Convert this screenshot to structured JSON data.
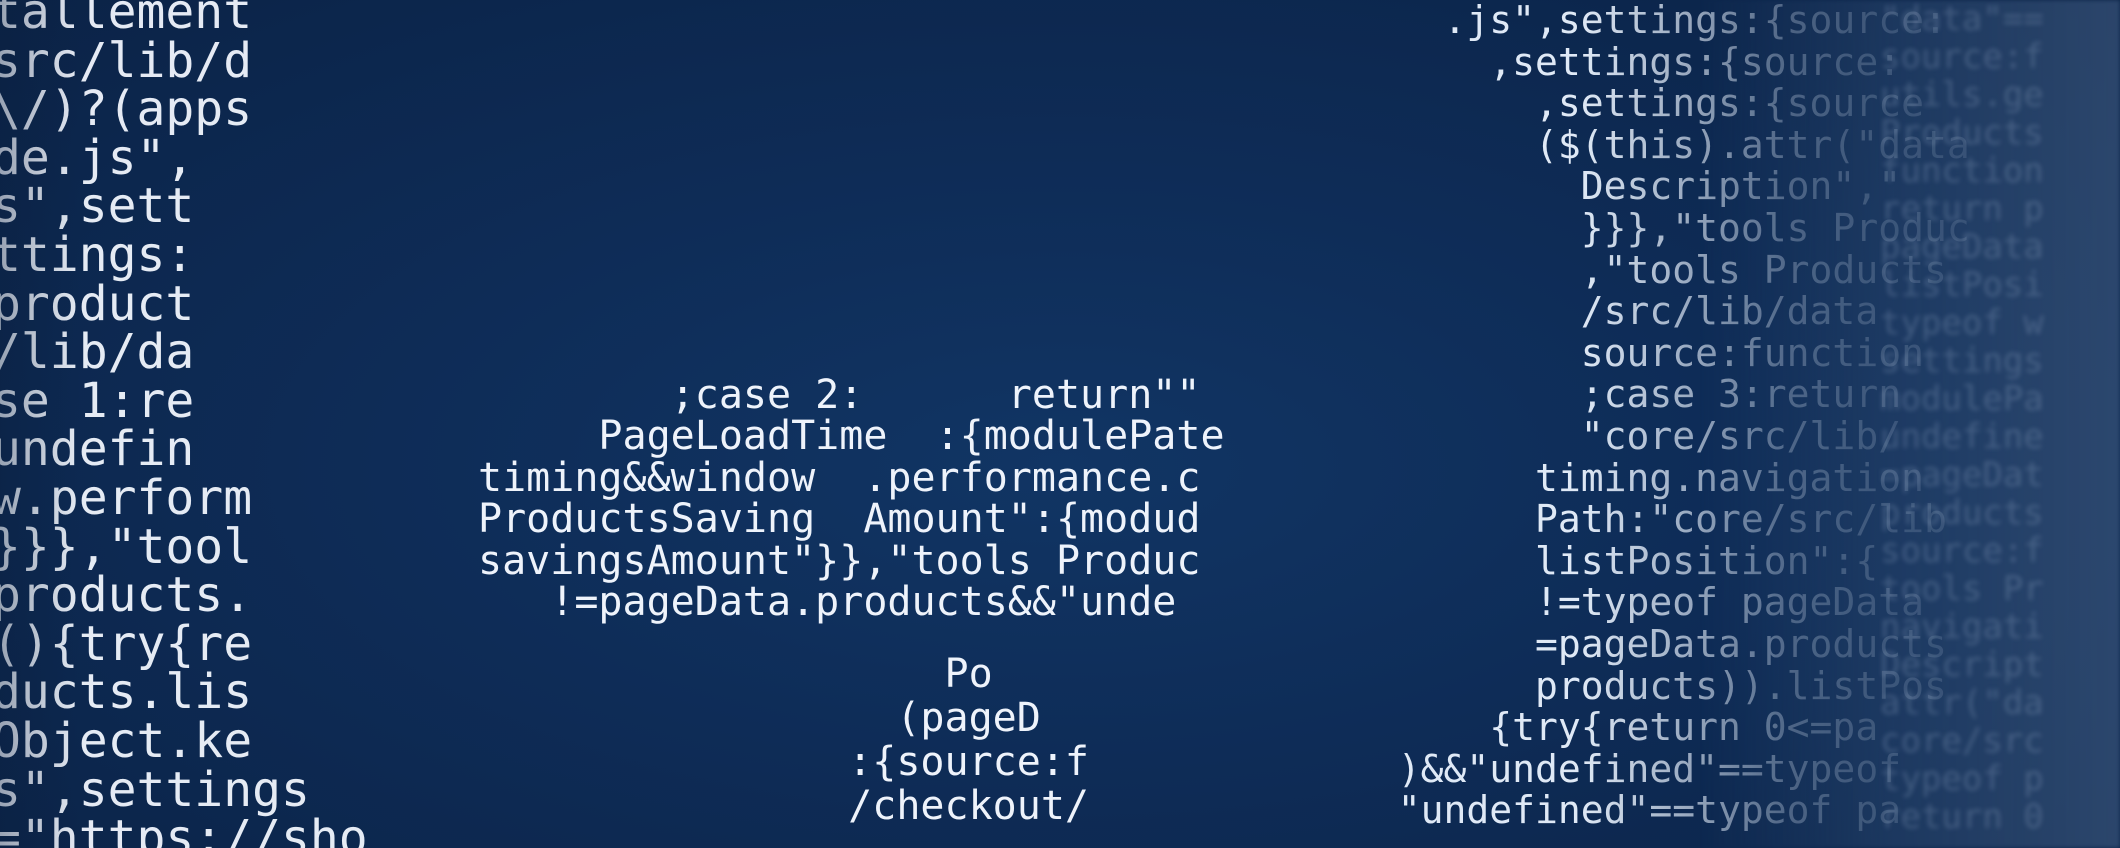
{
  "colors": {
    "background": "#0f2a52",
    "code_text": "#eef3fb"
  },
  "left_block": {
    "lines": [
      "tallement",
      "src/lib/d",
      "\\/)?(apps",
      "de.js\",",
      "s\",sett",
      "ttings:",
      "product",
      "/lib/da",
      "se 1:re",
      "undefin",
      "w.perform",
      "}}},\"tool",
      "products.",
      "(){try{re",
      "ducts.lis",
      "Object.ke",
      "s\",settings",
      "=\"https://sho"
    ]
  },
  "center_upper_block": {
    "lines": [
      "        ;case 2:      return\"\"",
      "     PageLoadTime  :{modulePate",
      "timing&&window  .performance.c",
      "ProductsSaving  Amount\":{modud",
      "savingsAmount\"}},\"tools Produc",
      "   !=pageData.products&&\"unde"
    ]
  },
  "center_lower_block": {
    "lines": [
      "      Po",
      "    (pageD",
      "  :{source:f",
      "  /checkout/"
    ]
  },
  "right_block": {
    "lines": [
      "    .js\",settings:{source:",
      "      ,settings:{source:",
      "        ,settings:{source",
      "        ($(this).attr(\"data",
      "          Description\",\"",
      "          }}},\"tools Produc",
      "          ,\"tools Products",
      "          /src/lib/data",
      "          source:function",
      "          ;case 3:return",
      "          \"core/src/lib/",
      "        timing.navigation",
      "        Path:\"core/src/lib",
      "        listPosition\":{",
      "        !=typeof pageData",
      "        =pageData.products",
      "        products)).listPos",
      "      {try{return 0<=pa",
      "  )&&\"undefined\"==typeof",
      "  \"undefined\"==typeof pa"
    ]
  },
  "far_right_texture": {
    "lines": [
      "\"data\"==",
      "source:f",
      "utils.ge",
      "Products",
      "function",
      "return p",
      "pageData",
      "listPosi",
      "typeof w",
      "settings",
      "modulePa",
      "undefine",
      "=pageDat",
      "products",
      "source:f",
      "tools Pr",
      "navigati",
      "Descript",
      "attr(\"da",
      "core/src",
      "typeof p",
      "return 0"
    ]
  }
}
